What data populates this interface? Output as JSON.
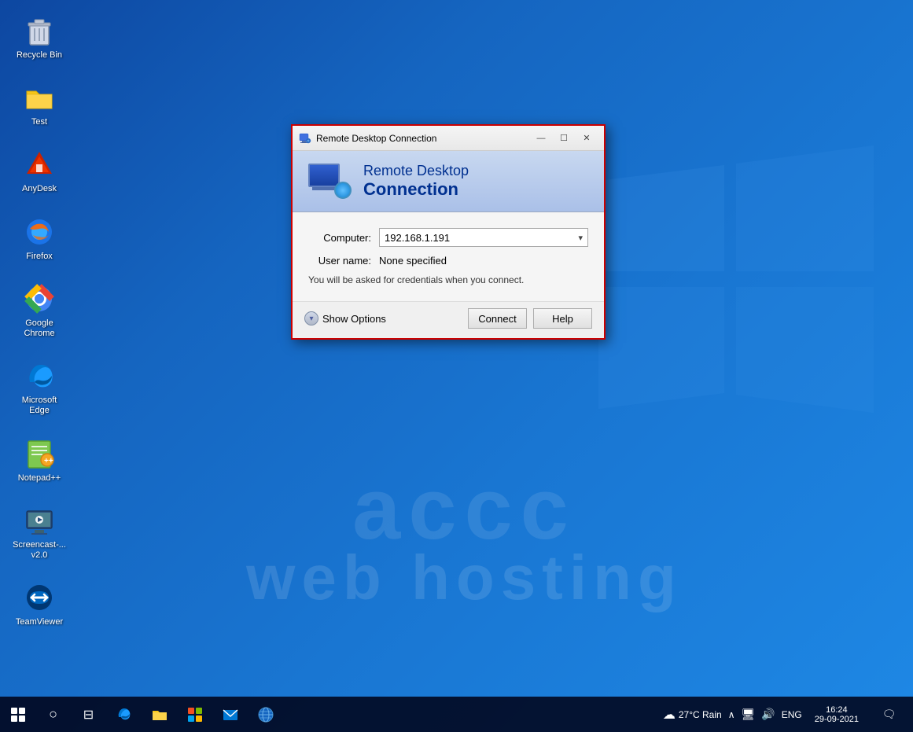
{
  "desktop": {
    "icons": [
      {
        "id": "recycle-bin",
        "label": "Recycle Bin",
        "emoji": "🗑"
      },
      {
        "id": "test",
        "label": "Test",
        "emoji": "📁"
      },
      {
        "id": "anydesk",
        "label": "AnyDesk",
        "emoji": "❤"
      },
      {
        "id": "firefox",
        "label": "Firefox",
        "emoji": "🦊"
      },
      {
        "id": "google-chrome",
        "label": "Google Chrome",
        "emoji": "🌐"
      },
      {
        "id": "microsoft-edge",
        "label": "Microsoft Edge",
        "emoji": "🌊"
      },
      {
        "id": "notepadpp",
        "label": "Notepad++",
        "emoji": "📝"
      },
      {
        "id": "screencast",
        "label": "Screencast-...\nv2.0",
        "emoji": "📹"
      },
      {
        "id": "teamviewer",
        "label": "TeamViewer",
        "emoji": "↔"
      }
    ],
    "watermark": {
      "line1": "accc",
      "line2": "web hosting"
    }
  },
  "rdp_dialog": {
    "title": "Remote Desktop Connection",
    "header_title_line1": "Remote Desktop",
    "header_title_line2": "Connection",
    "computer_label": "Computer:",
    "computer_value": "192.168.1.191",
    "username_label": "User name:",
    "username_value": "None specified",
    "info_text": "You will be asked for credentials when you connect.",
    "show_options_label": "Show Options",
    "connect_button": "Connect",
    "help_button": "Help",
    "window_controls": {
      "minimize": "—",
      "maximize": "☐",
      "close": "✕"
    }
  },
  "taskbar": {
    "start_tooltip": "Start",
    "search_tooltip": "Search",
    "taskview_tooltip": "Task View",
    "weather": "27°C Rain",
    "language": "ENG",
    "time": "16:24",
    "date": "29-09-2021",
    "icons": [
      {
        "id": "search",
        "emoji": "○"
      },
      {
        "id": "taskview",
        "emoji": "⊟"
      },
      {
        "id": "edge",
        "emoji": "🌊"
      },
      {
        "id": "explorer",
        "emoji": "📁"
      },
      {
        "id": "store",
        "emoji": "🛍"
      },
      {
        "id": "mail",
        "emoji": "✉"
      },
      {
        "id": "globe",
        "emoji": "🌐"
      }
    ]
  }
}
